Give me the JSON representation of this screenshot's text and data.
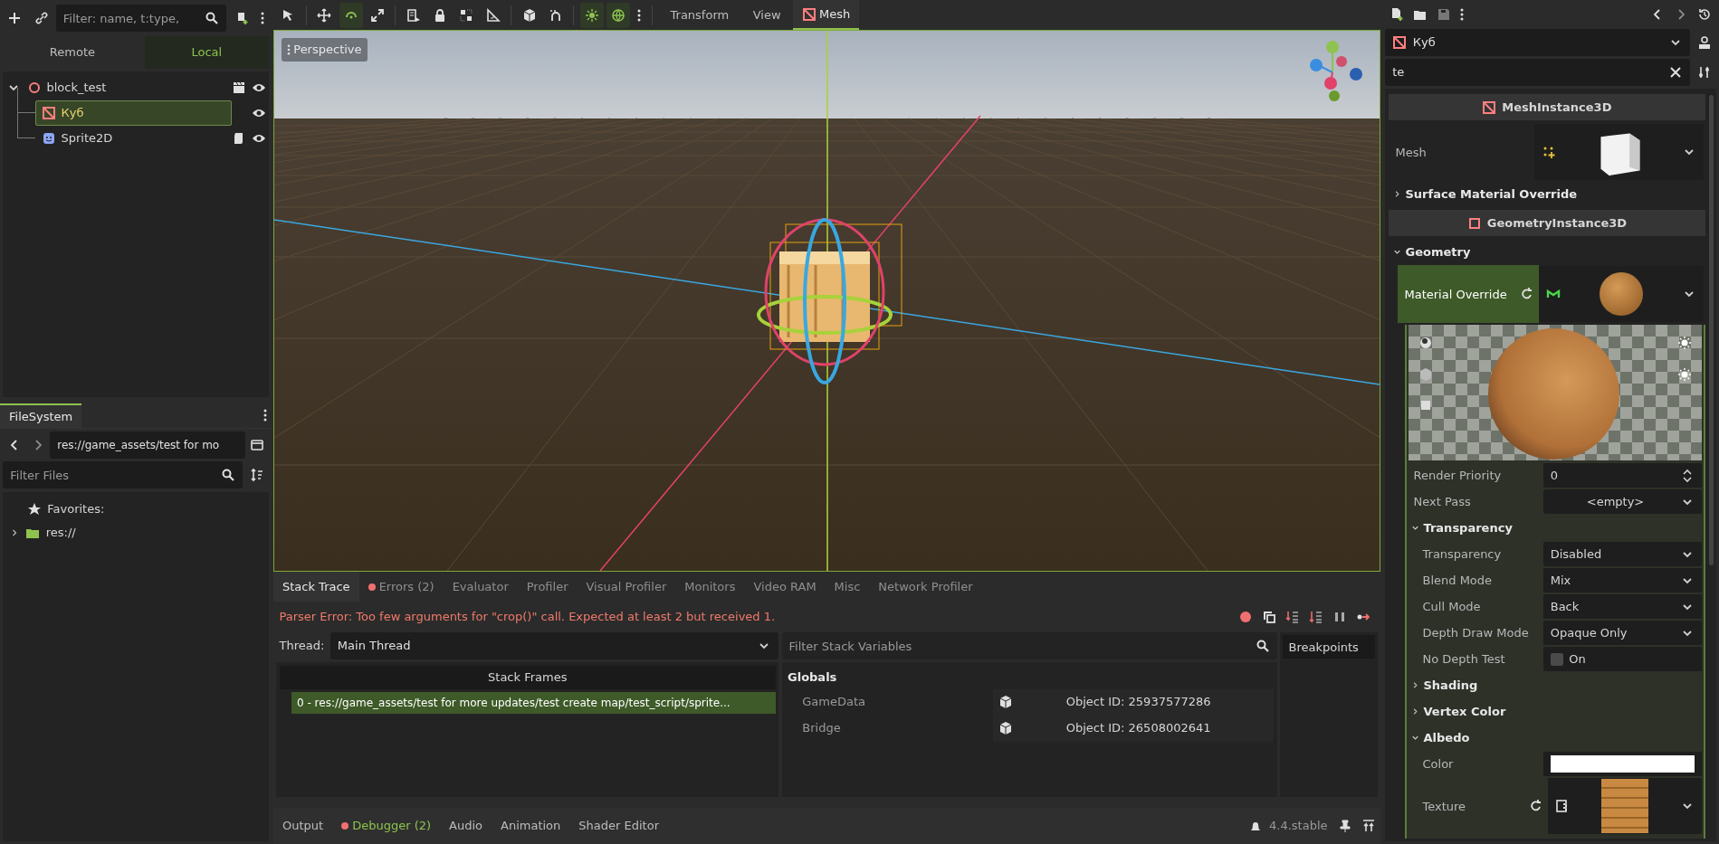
{
  "scene_dock": {
    "filter_placeholder": "Filter: name, t:type,",
    "tabs": [
      {
        "label": "Remote",
        "selected": false
      },
      {
        "label": "Local",
        "selected": true
      }
    ],
    "tree": [
      {
        "label": "block_test",
        "kind": "node3d",
        "expanded": true,
        "selected": false,
        "open_in_editor": true,
        "script": false,
        "children": [
          {
            "label": "Куб",
            "kind": "mesh",
            "selected": true,
            "open_in_editor": false,
            "script": false
          },
          {
            "label": "Sprite2D",
            "kind": "sprite",
            "selected": false,
            "open_in_editor": false,
            "script": true
          }
        ]
      }
    ]
  },
  "filesystem": {
    "tab": "FileSystem",
    "path": "res://game_assets/test for mo",
    "filter_placeholder": "Filter Files",
    "items": [
      {
        "label": "Favorites:",
        "kind": "favorites"
      },
      {
        "label": "res://",
        "kind": "folder"
      }
    ]
  },
  "viewport": {
    "tools": [
      {
        "kind": "cursor",
        "selected": false
      },
      {
        "kind": "move",
        "selected": false
      },
      {
        "kind": "rotate",
        "selected": true
      },
      {
        "kind": "scale",
        "selected": false
      },
      {
        "kind": "list",
        "selected": false
      },
      {
        "kind": "lock",
        "selected": false
      },
      {
        "kind": "group",
        "selected": false
      },
      {
        "kind": "ruler",
        "selected": false
      },
      {
        "kind": "cube",
        "selected": false
      },
      {
        "kind": "snap",
        "selected": false
      },
      {
        "kind": "sun",
        "selected": true
      },
      {
        "kind": "globe",
        "selected": true
      },
      {
        "kind": "more",
        "selected": false
      }
    ],
    "menus": [
      {
        "label": "Transform",
        "selected": false
      },
      {
        "label": "View",
        "selected": false
      },
      {
        "label": "Mesh",
        "selected": true
      }
    ],
    "perspective_label": "Perspective"
  },
  "debugger": {
    "tabs": [
      {
        "label": "Stack Trace",
        "selected": true,
        "error_dot": false
      },
      {
        "label": "Errors (2)",
        "selected": false,
        "error_dot": true
      },
      {
        "label": "Evaluator",
        "selected": false,
        "error_dot": false
      },
      {
        "label": "Profiler",
        "selected": false,
        "error_dot": false
      },
      {
        "label": "Visual Profiler",
        "selected": false,
        "error_dot": false
      },
      {
        "label": "Monitors",
        "selected": false,
        "error_dot": false
      },
      {
        "label": "Video RAM",
        "selected": false,
        "error_dot": false
      },
      {
        "label": "Misc",
        "selected": false,
        "error_dot": false
      },
      {
        "label": "Network Profiler",
        "selected": false,
        "error_dot": false
      }
    ],
    "error_message": "Parser Error: Too few arguments for \"crop()\" call. Expected at least 2 but received 1.",
    "thread_label": "Thread:",
    "thread_value": "Main Thread",
    "frames_header": "Stack Frames",
    "frames": [
      {
        "text": "0 - res://game_assets/test for more updates/test create map/test_script/sprite...",
        "selected": true
      }
    ],
    "filter_placeholder": "Filter Stack Variables",
    "variables_header": "Globals",
    "variables": [
      {
        "name": "GameData",
        "value": "Object ID: 25937577286"
      },
      {
        "name": "Bridge",
        "value": "Object ID: 26508002641"
      }
    ],
    "breakpoints_label": "Breakpoints"
  },
  "bottom_tabs": [
    {
      "label": "Output",
      "selected": false,
      "error_dot": false
    },
    {
      "label": "Debugger (2)",
      "selected": true,
      "error_dot": true
    },
    {
      "label": "Audio",
      "selected": false,
      "error_dot": false
    },
    {
      "label": "Animation",
      "selected": false,
      "error_dot": false
    },
    {
      "label": "Shader Editor",
      "selected": false,
      "error_dot": false
    }
  ],
  "version": "4.4.stable",
  "inspector": {
    "node_name": "Куб",
    "search_value": "te",
    "rows": [
      {
        "kind": "category",
        "label": "MeshInstance3D"
      },
      {
        "kind": "mesh_resource",
        "label": "Mesh",
        "selected": false,
        "revertable": false
      },
      {
        "kind": "group",
        "label": "Surface Material Override",
        "expanded": false
      },
      {
        "kind": "category",
        "label": "GeometryInstance3D"
      },
      {
        "kind": "group",
        "label": "Geometry",
        "expanded": true,
        "children": [
          {
            "kind": "material_resource",
            "label": "Material Override",
            "selected": true,
            "revertable": true,
            "children": [
              {
                "kind": "material_preview"
              },
              {
                "kind": "spin",
                "label": "Render Priority",
                "value": "0"
              },
              {
                "kind": "empty_resource",
                "label": "Next Pass",
                "value": "<empty>"
              },
              {
                "kind": "group",
                "label": "Transparency",
                "expanded": true,
                "children": [
                  {
                    "kind": "enum",
                    "label": "Transparency",
                    "value": "Disabled"
                  },
                  {
                    "kind": "enum",
                    "label": "Blend Mode",
                    "value": "Mix"
                  },
                  {
                    "kind": "enum",
                    "label": "Cull Mode",
                    "value": "Back"
                  },
                  {
                    "kind": "enum",
                    "label": "Depth Draw Mode",
                    "value": "Opaque Only"
                  },
                  {
                    "kind": "check",
                    "label": "No Depth Test",
                    "value": "On",
                    "checked": false
                  }
                ]
              },
              {
                "kind": "group",
                "label": "Shading",
                "expanded": false
              },
              {
                "kind": "group",
                "label": "Vertex Color",
                "expanded": false
              },
              {
                "kind": "group",
                "label": "Albedo",
                "expanded": true,
                "children": [
                  {
                    "kind": "color",
                    "label": "Color"
                  },
                  {
                    "kind": "texture_resource",
                    "label": "Texture",
                    "selected": false,
                    "revertable": true
                  }
                ]
              }
            ]
          }
        ]
      }
    ]
  }
}
